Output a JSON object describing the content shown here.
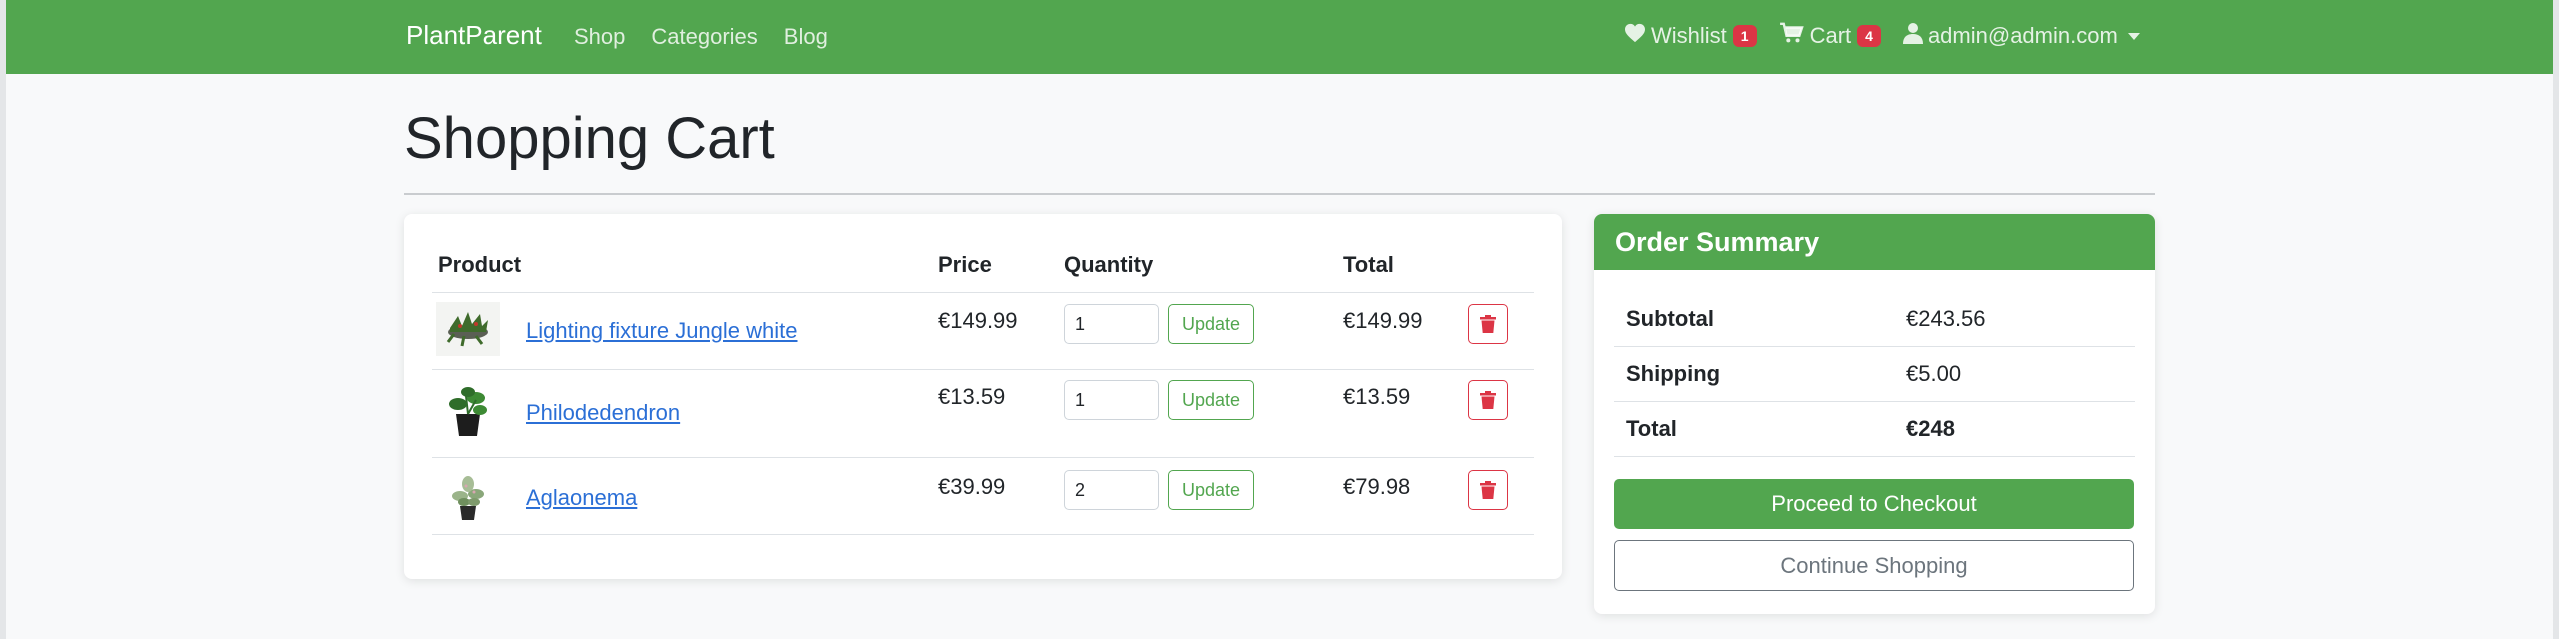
{
  "navbar": {
    "brand": "PlantParent",
    "links": [
      "Shop",
      "Categories",
      "Blog"
    ],
    "wishlist": {
      "label": "Wishlist",
      "count": "1"
    },
    "cart": {
      "label": "Cart",
      "count": "4"
    },
    "user": {
      "label": "admin@admin.com"
    },
    "bg_color": "#52a64f"
  },
  "page": {
    "title": "Shopping Cart"
  },
  "cart": {
    "headers": {
      "product": "Product",
      "price": "Price",
      "quantity": "Quantity",
      "total": "Total"
    },
    "update_label": "Update",
    "rows": [
      {
        "name": "Lighting fixture Jungle white",
        "price": "€149.99",
        "qty": "1",
        "total": "€149.99"
      },
      {
        "name": "Philodedendron",
        "price": "€13.59",
        "qty": "1",
        "total": "€13.59"
      },
      {
        "name": "Aglaonema",
        "price": "€39.99",
        "qty": "2",
        "total": "€79.98"
      }
    ]
  },
  "summary": {
    "title": "Order Summary",
    "subtotal_label": "Subtotal",
    "subtotal_value": "€243.56",
    "shipping_label": "Shipping",
    "shipping_value": "€5.00",
    "total_label": "Total",
    "total_value": "€248",
    "checkout_label": "Proceed to Checkout",
    "continue_label": "Continue Shopping"
  },
  "icons": [
    "heart-icon",
    "cart-icon",
    "user-icon",
    "trash-icon",
    "dropdown-caret-icon"
  ],
  "colors": {
    "accent": "#52a64f",
    "danger": "#dc3545",
    "link": "#2b6fd6"
  }
}
